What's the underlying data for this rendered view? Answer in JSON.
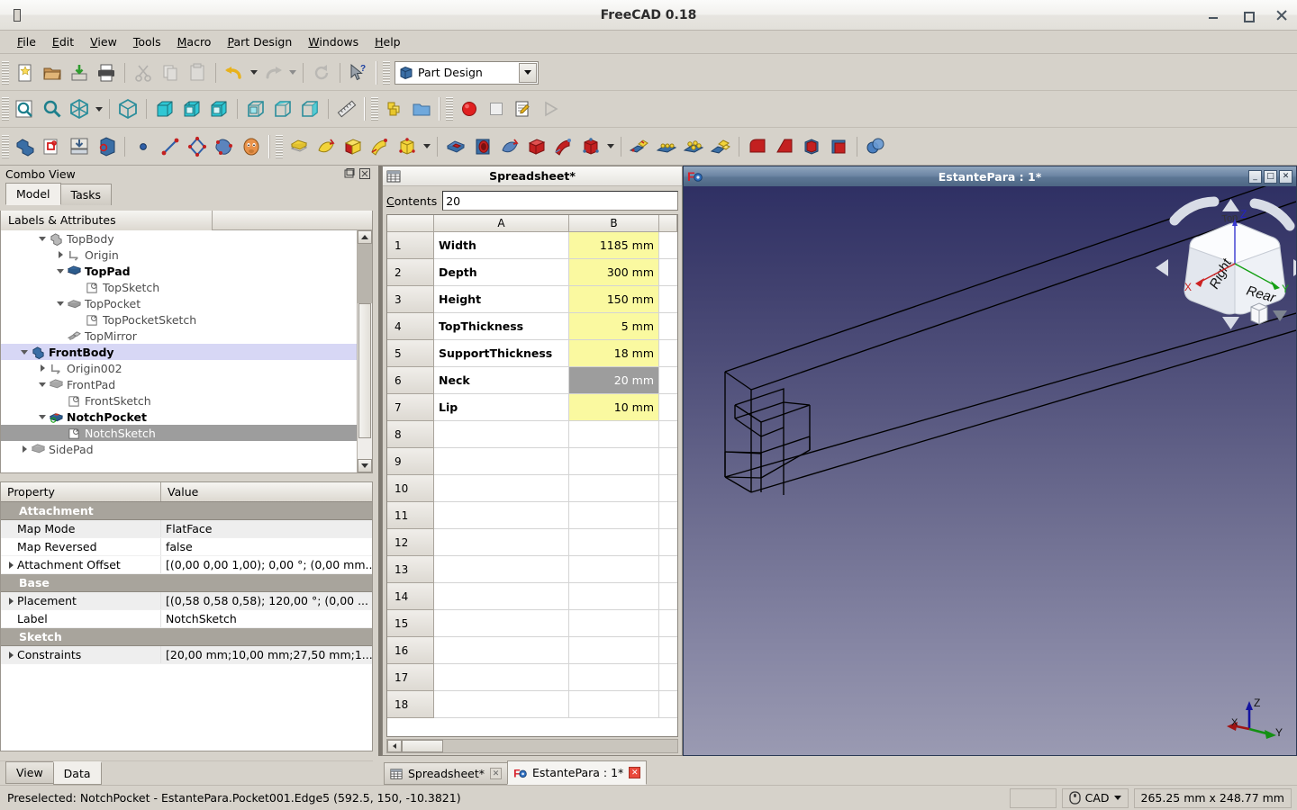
{
  "window": {
    "title": "FreeCAD 0.18",
    "app_icon": "freecad-icon",
    "minimize_label": "Minimize",
    "maximize_label": "Maximize",
    "close_label": "Close"
  },
  "menubar": {
    "items": [
      {
        "label": "File",
        "mnemonic": "F"
      },
      {
        "label": "Edit",
        "mnemonic": "E"
      },
      {
        "label": "View",
        "mnemonic": "V"
      },
      {
        "label": "Tools",
        "mnemonic": "T"
      },
      {
        "label": "Macro",
        "mnemonic": "M"
      },
      {
        "label": "Part Design",
        "mnemonic": "P"
      },
      {
        "label": "Windows",
        "mnemonic": "W"
      },
      {
        "label": "Help",
        "mnemonic": "H"
      }
    ]
  },
  "workbench": {
    "selected": "Part Design"
  },
  "toolbars": {
    "file": [
      "new-document-icon",
      "open-document-icon",
      "save-document-icon",
      "print-icon"
    ],
    "edit": [
      "cut-icon",
      "copy-icon",
      "paste-icon",
      "undo-icon",
      "redo-icon",
      "refresh-icon",
      "whats-this-icon"
    ],
    "macro": [
      "macros-icon",
      "macro-folder-icon",
      "macro-record-icon",
      "macro-stop-icon",
      "macro-edit-icon",
      "macro-execute-icon"
    ],
    "view": [
      "fit-all-icon",
      "fit-selection-icon",
      "axonometric-icon",
      "isometric-icon",
      "front-view-icon",
      "top-view-icon",
      "right-view-icon",
      "rear-view-icon",
      "bottom-view-icon",
      "left-view-icon",
      "measure-icon"
    ],
    "structure": [
      "create-part-icon",
      "create-body-icon",
      "create-group-icon",
      "make-link-icon"
    ],
    "sketcher": [
      "create-point-icon",
      "create-line-icon",
      "create-polyline-icon",
      "create-bspline-icon",
      "sketcher-icon"
    ],
    "additive": [
      "pad-icon",
      "revolution-icon",
      "additive-loft-icon",
      "additive-pipe-icon",
      "additive-box-icon"
    ],
    "subtractive": [
      "pocket-icon",
      "hole-icon",
      "groove-icon",
      "subtractive-loft-icon",
      "subtractive-pipe-icon",
      "subtractive-box-icon"
    ],
    "transform": [
      "mirrored-icon",
      "linear-pattern-icon",
      "polar-pattern-icon",
      "multi-transform-icon"
    ],
    "dressup": [
      "fillet-icon",
      "chamfer-icon",
      "draft-icon",
      "thickness-icon"
    ],
    "boolean": [
      "boolean-operation-icon"
    ]
  },
  "combo_view": {
    "title": "Combo View",
    "float_button": "float-icon",
    "close_button": "close-icon",
    "tabs": [
      {
        "label": "Model",
        "active": true
      },
      {
        "label": "Tasks",
        "active": false
      }
    ],
    "tree_header": "Labels & Attributes",
    "tree": [
      {
        "label": "TopBody",
        "indent": 2,
        "arrow": "down",
        "icon": "body-icon",
        "style": "normal"
      },
      {
        "label": "Origin",
        "indent": 3,
        "arrow": "right",
        "icon": "origin-icon",
        "style": "normal"
      },
      {
        "label": "TopPad",
        "indent": 3,
        "arrow": "down",
        "icon": "pad-icon",
        "style": "bold"
      },
      {
        "label": "TopSketch",
        "indent": 4,
        "arrow": "none",
        "icon": "sketch-icon",
        "style": "normal"
      },
      {
        "label": "TopPocket",
        "indent": 3,
        "arrow": "down",
        "icon": "pocket-icon",
        "style": "normal"
      },
      {
        "label": "TopPocketSketch",
        "indent": 4,
        "arrow": "none",
        "icon": "sketch-icon",
        "style": "normal"
      },
      {
        "label": "TopMirror",
        "indent": 3,
        "arrow": "none",
        "icon": "mirror-icon",
        "style": "normal"
      },
      {
        "label": "FrontBody",
        "indent": 1,
        "arrow": "down",
        "icon": "body-active-icon",
        "style": "bold",
        "highlight": "blue"
      },
      {
        "label": "Origin002",
        "indent": 2,
        "arrow": "right",
        "icon": "origin-icon",
        "style": "normal"
      },
      {
        "label": "FrontPad",
        "indent": 2,
        "arrow": "down",
        "icon": "pad-gray-icon",
        "style": "normal"
      },
      {
        "label": "FrontSketch",
        "indent": 3,
        "arrow": "none",
        "icon": "sketch-icon",
        "style": "normal"
      },
      {
        "label": "NotchPocket",
        "indent": 2,
        "arrow": "down",
        "icon": "pocket-tip-icon",
        "style": "bold"
      },
      {
        "label": "NotchSketch",
        "indent": 3,
        "arrow": "none",
        "icon": "sketch-icon",
        "style": "normal",
        "highlight": "gray"
      },
      {
        "label": "SidePad",
        "indent": 1,
        "arrow": "right",
        "icon": "pad-gray-icon",
        "style": "normal"
      }
    ]
  },
  "property_editor": {
    "headers": [
      "Property",
      "Value"
    ],
    "rows": [
      {
        "kind": "group",
        "name": "Attachment"
      },
      {
        "kind": "item",
        "name": "Map Mode",
        "value": "FlatFace",
        "expandable": false,
        "alt": true
      },
      {
        "kind": "item",
        "name": "Map Reversed",
        "value": "false",
        "expandable": false,
        "alt": false
      },
      {
        "kind": "item",
        "name": "Attachment Offset",
        "value": "[(0,00 0,00 1,00); 0,00 °; (0,00 mm...",
        "expandable": true,
        "alt": false
      },
      {
        "kind": "group",
        "name": "Base"
      },
      {
        "kind": "item",
        "name": "Placement",
        "value": "[(0,58 0,58 0,58); 120,00 °; (0,00 ...",
        "expandable": true,
        "alt": true
      },
      {
        "kind": "item",
        "name": "Label",
        "value": "NotchSketch",
        "expandable": false,
        "alt": false
      },
      {
        "kind": "group",
        "name": "Sketch"
      },
      {
        "kind": "item",
        "name": "Constraints",
        "value": "[20,00 mm;10,00 mm;27,50 mm;1...",
        "expandable": true,
        "alt": true
      }
    ],
    "bottom_tabs": [
      {
        "label": "View",
        "active": false
      },
      {
        "label": "Data",
        "active": true
      }
    ]
  },
  "spreadsheet_window": {
    "title": "Spreadsheet*",
    "icon": "spreadsheet-icon",
    "contents_label": "Contents",
    "contents_mnemonic": "C",
    "contents_value": "20",
    "columns": [
      "",
      "A",
      "B",
      ""
    ],
    "rows": [
      {
        "n": "1",
        "a": "Width",
        "b": "1185 mm",
        "b_style": "yellow"
      },
      {
        "n": "2",
        "a": "Depth",
        "b": "300 mm",
        "b_style": "yellow"
      },
      {
        "n": "3",
        "a": "Height",
        "b": "150 mm",
        "b_style": "yellow"
      },
      {
        "n": "4",
        "a": "TopThickness",
        "b": "5 mm",
        "b_style": "yellow"
      },
      {
        "n": "5",
        "a": "SupportThickness",
        "b": "18 mm",
        "b_style": "yellow"
      },
      {
        "n": "6",
        "a": "Neck",
        "b": "20 mm",
        "b_style": "selected"
      },
      {
        "n": "7",
        "a": "Lip",
        "b": "10 mm",
        "b_style": "yellow"
      },
      {
        "n": "8",
        "a": "",
        "b": "",
        "b_style": ""
      },
      {
        "n": "9",
        "a": "",
        "b": "",
        "b_style": ""
      },
      {
        "n": "10",
        "a": "",
        "b": "",
        "b_style": ""
      },
      {
        "n": "11",
        "a": "",
        "b": "",
        "b_style": ""
      },
      {
        "n": "12",
        "a": "",
        "b": "",
        "b_style": ""
      },
      {
        "n": "13",
        "a": "",
        "b": "",
        "b_style": ""
      },
      {
        "n": "14",
        "a": "",
        "b": "",
        "b_style": ""
      },
      {
        "n": "15",
        "a": "",
        "b": "",
        "b_style": ""
      },
      {
        "n": "16",
        "a": "",
        "b": "",
        "b_style": ""
      },
      {
        "n": "17",
        "a": "",
        "b": "",
        "b_style": ""
      },
      {
        "n": "18",
        "a": "",
        "b": "",
        "b_style": ""
      }
    ]
  },
  "view3d_window": {
    "title": "EstantePara : 1*",
    "icon": "freecad-doc-icon",
    "minimize_label": "_",
    "restore_label": "□",
    "close_label": "✕",
    "navigation_cube": {
      "visible_faces": [
        "Top",
        "Right",
        "Rear"
      ],
      "axes": [
        "X",
        "Y",
        "Z"
      ]
    },
    "axis_cross": {
      "x": "X",
      "y": "Y",
      "z": "Z"
    },
    "background_top": "#2f3064",
    "background_bottom": "#9a9ab2"
  },
  "mdi_tabs": [
    {
      "label": "Spreadsheet*",
      "icon": "spreadsheet-icon",
      "active": false,
      "close": "✕"
    },
    {
      "label": "EstantePara : 1*",
      "icon": "freecad-doc-icon",
      "active": true,
      "close": "✕"
    }
  ],
  "statusbar": {
    "message": "Preselected: NotchPocket - EstantePara.Pocket001.Edge5 (592.5, 150, -10.3821)",
    "nav_style": "CAD",
    "nav_icon": "mouse-icon",
    "dimensions": "265.25 mm x 248.77 mm"
  }
}
